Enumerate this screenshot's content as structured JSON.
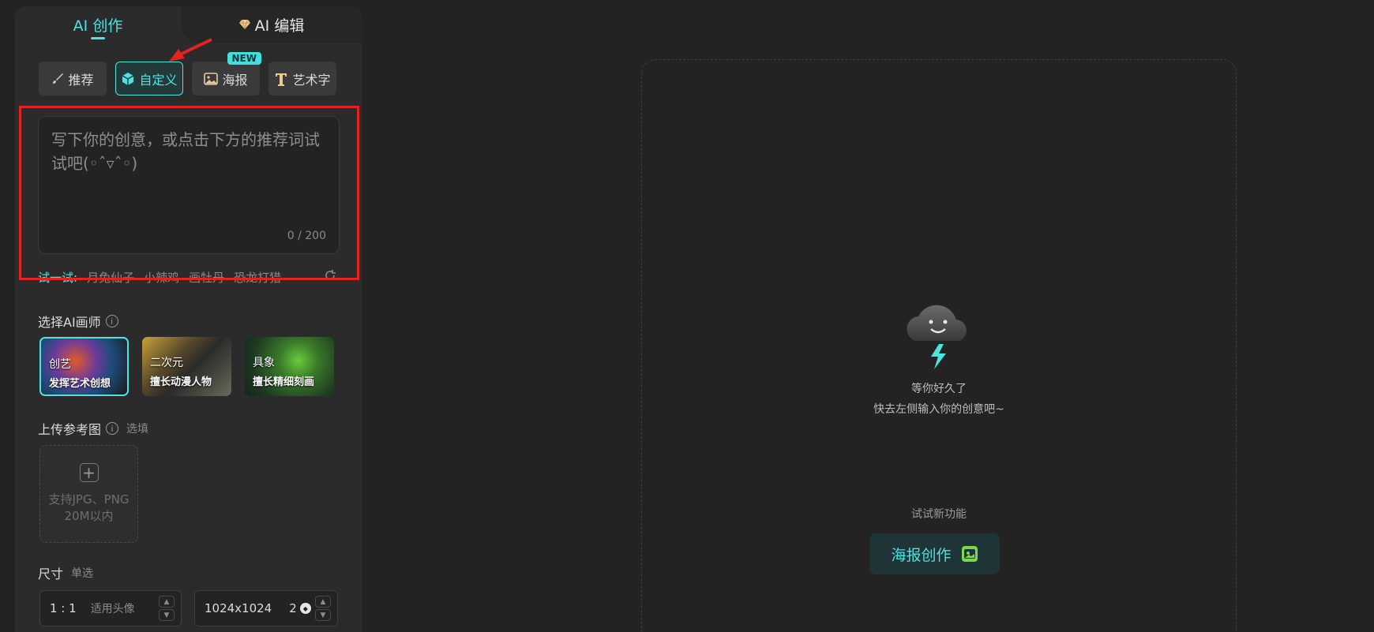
{
  "tabs": {
    "create": "AI 创作",
    "edit": "AI 编辑"
  },
  "modes": [
    {
      "label": "推荐",
      "icon": "brush-icon"
    },
    {
      "label": "自定义",
      "icon": "cube-icon",
      "active": true
    },
    {
      "label": "海报",
      "icon": "image-icon",
      "badge": "NEW"
    },
    {
      "label": "艺术字",
      "icon": "art-text-icon"
    }
  ],
  "prompt": {
    "placeholder": "写下你的创意，或点击下方的推荐词试试吧(◦ˆ▿ˆ◦)",
    "counter": "0 / 200"
  },
  "try": {
    "label": "试一试:",
    "items": [
      "月兔仙子",
      "小辣鸡",
      "画牡丹",
      "恐龙打猎"
    ]
  },
  "painter_section": {
    "title": "选择AI画师"
  },
  "painters": [
    {
      "title": "创艺",
      "sub": "发挥艺术创想"
    },
    {
      "title": "二次元",
      "sub": "擅长动漫人物"
    },
    {
      "title": "具象",
      "sub": "擅长精细刻画"
    }
  ],
  "upload": {
    "title": "上传参考图",
    "hint": "选填",
    "line1": "支持JPG、PNG",
    "line2": "20M以内"
  },
  "size": {
    "title": "尺寸",
    "hint": "单选",
    "ratio": "1 : 1",
    "ratio_note": "适用头像",
    "resolution": "1024x1024",
    "count": "2"
  },
  "empty": {
    "line1": "等你好久了",
    "line2": "快去左侧输入你的创意吧~"
  },
  "feature": {
    "label": "试试新功能",
    "button": "海报创作"
  },
  "colors": {
    "accent": "#4fe3e0",
    "highlight": "#e32222"
  }
}
